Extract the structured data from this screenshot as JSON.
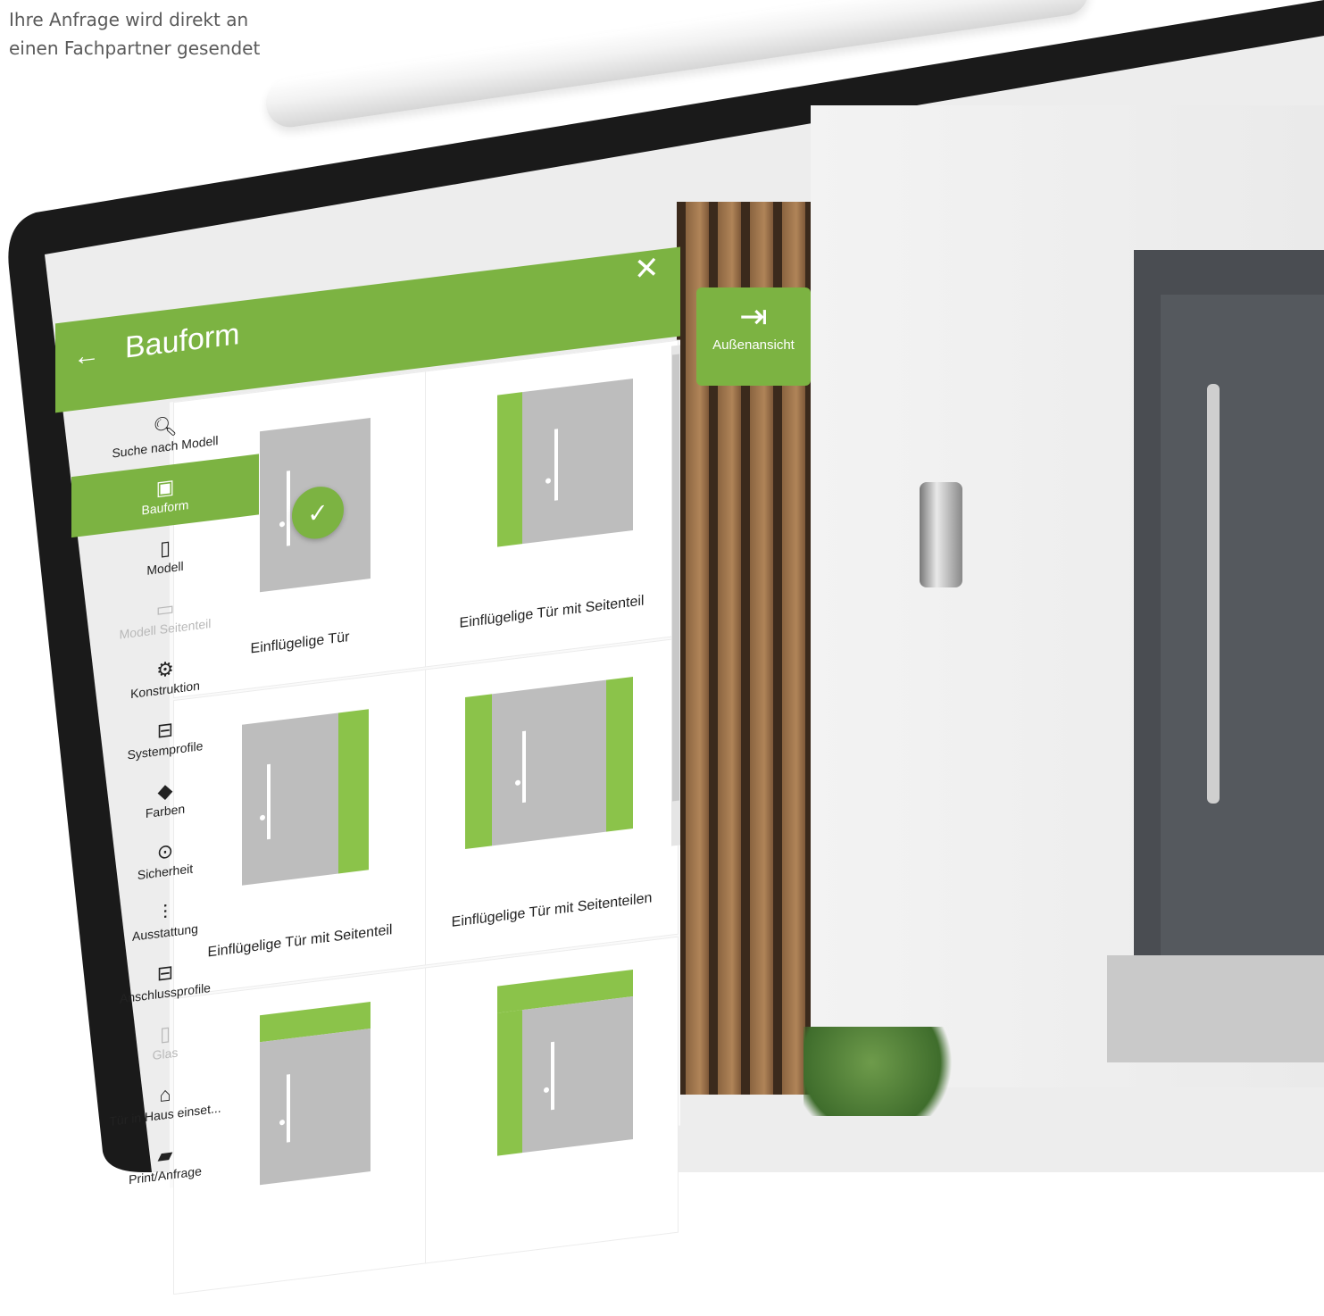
{
  "caption": {
    "line1": "Ihre Anfrage wird direkt an",
    "line2": "einen Fachpartner gesendet"
  },
  "header": {
    "back_icon": "arrow-left-icon",
    "title": "Bauform",
    "close_icon": "close-icon"
  },
  "nav": {
    "items": [
      {
        "label": "Suche nach Modell",
        "icon": "search-icon",
        "state": "normal"
      },
      {
        "label": "Bauform",
        "icon": "layout-icon",
        "state": "active"
      },
      {
        "label": "Modell",
        "icon": "door-icon",
        "state": "normal"
      },
      {
        "label": "Modell Seitenteil",
        "icon": "sidepanel-icon",
        "state": "disabled"
      },
      {
        "label": "Konstruktion",
        "icon": "gear-icon",
        "state": "normal"
      },
      {
        "label": "Systemprofile",
        "icon": "profile-icon",
        "state": "normal"
      },
      {
        "label": "Farben",
        "icon": "paint-bucket-icon",
        "state": "normal"
      },
      {
        "label": "Sicherheit",
        "icon": "lock-icon",
        "state": "normal"
      },
      {
        "label": "Ausstattung",
        "icon": "handle-icon",
        "state": "normal"
      },
      {
        "label": "Anschlussprofile",
        "icon": "profile-icon",
        "state": "normal"
      },
      {
        "label": "Glas",
        "icon": "glass-icon",
        "state": "disabled"
      },
      {
        "label": "Tür in Haus einset...",
        "icon": "house-icon",
        "state": "normal"
      },
      {
        "label": "Print/Anfrage",
        "icon": "briefcase-icon",
        "state": "normal"
      }
    ]
  },
  "cards": [
    {
      "label": "Einflügelige Tür",
      "selected": true
    },
    {
      "label": "Einflügelige Tür mit Seitenteil",
      "selected": false
    },
    {
      "label": "Einflügelige Tür mit Seitenteil",
      "selected": false
    },
    {
      "label": "Einflügelige Tür mit Seitenteilen",
      "selected": false
    },
    {
      "label": "",
      "selected": false
    },
    {
      "label": "",
      "selected": false
    }
  ],
  "view_button": {
    "label": "Außenansicht",
    "icon": "exit-door-icon"
  },
  "colors": {
    "accent": "#7cb342",
    "side_panel": "#8bc34a",
    "door_gray": "#bdbdbd"
  }
}
